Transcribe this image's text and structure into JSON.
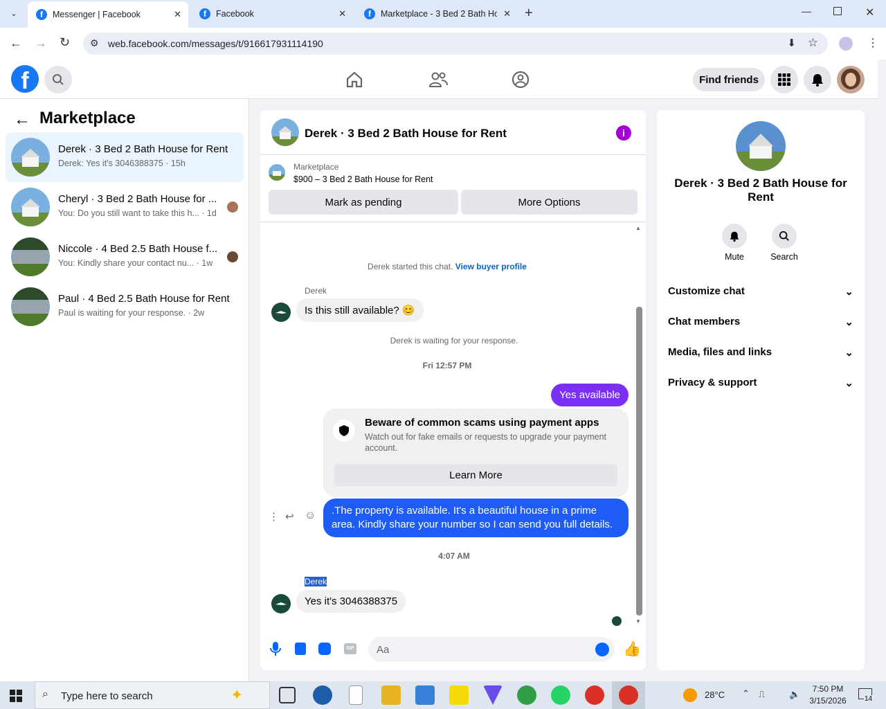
{
  "browser": {
    "tabs": [
      {
        "title": "Messenger | Facebook"
      },
      {
        "title": "Facebook"
      },
      {
        "title": "Marketplace - 3 Bed 2 Bath Hou"
      }
    ],
    "url": "web.facebook.com/messages/t/916617931114190"
  },
  "header": {
    "find_friends": "Find friends"
  },
  "left": {
    "title": "Marketplace",
    "conversations": [
      {
        "title": "Derek · 3 Bed 2 Bath House for Rent",
        "sub": "Derek: Yes it's 3046388375 · 15h"
      },
      {
        "title": "Cheryl · 3 Bed 2 Bath House for ...",
        "sub": "You: Do you still want to take this h... · 1d"
      },
      {
        "title": "Niccole · 4 Bed 2.5 Bath House f...",
        "sub": "You: Kindly share your contact nu... · 1w"
      },
      {
        "title": "Paul · 4 Bed 2.5 Bath House for Rent",
        "sub": "Paul is waiting for your response. · 2w"
      }
    ]
  },
  "chat": {
    "title": "Derek · 3 Bed 2 Bath House for Rent",
    "listing_label": "Marketplace",
    "listing_price": "$900 – 3 Bed 2 Bath House for Rent",
    "mark_pending": "Mark as pending",
    "more_options": "More Options",
    "started_text": "Derek started this chat.",
    "view_profile": "View buyer profile",
    "sender1": "Derek",
    "msg1": "Is this still available? 😊",
    "waiting": "Derek is waiting for your response.",
    "time1": "Fri 12:57 PM",
    "msg_out1": "Yes available",
    "scam_title": "Beware of common scams using payment apps",
    "scam_body": "Watch out for fake emails or requests to upgrade your payment account.",
    "learn_more": "Learn More",
    "msg_out2": ".The property is available. It's a beautiful house in a prime area. Kindly share your number so I can send you full details.",
    "time2": "4:07 AM",
    "sender2": "Derek",
    "msg2": "Yes it's 3046388375",
    "input_placeholder": "Aa"
  },
  "right": {
    "title": "Derek · 3 Bed 2 Bath House for Rent",
    "mute": "Mute",
    "search": "Search",
    "rows": [
      "Customize chat",
      "Chat members",
      "Media, files and links",
      "Privacy & support"
    ]
  },
  "taskbar": {
    "search_placeholder": "Type here to search",
    "temp": "28°C",
    "time": "7:50 PM",
    "date": "3/15/2026",
    "notif_count": "14"
  },
  "colors": {
    "fb_blue": "#1877f2",
    "out_purple": "#7b2ff7",
    "out_blue": "#1f5cf5"
  }
}
